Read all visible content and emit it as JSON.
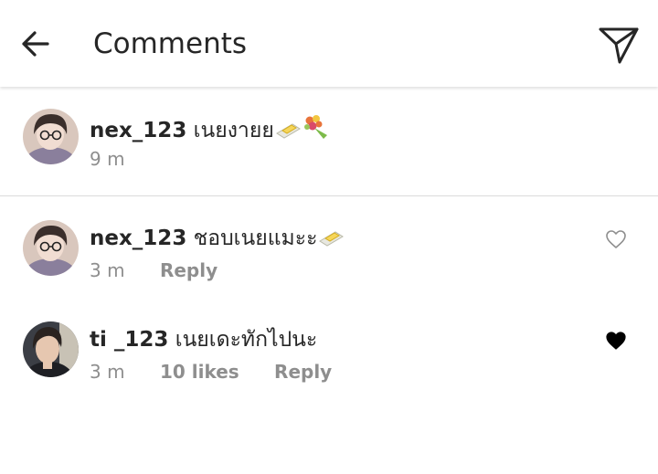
{
  "header": {
    "title": "Comments",
    "back_icon": "arrow-left-icon",
    "share_icon": "paper-plane-icon"
  },
  "caption": {
    "username": "nex_123",
    "text": "เนยงายย",
    "emojis": [
      "butter-emoji",
      "bouquet-emoji"
    ],
    "time": "9 m"
  },
  "comments": [
    {
      "username": "nex_123",
      "text": "ชอบเนยแมะะ",
      "emojis": [
        "butter-emoji"
      ],
      "time": "3 m",
      "likes": "",
      "reply_label": "Reply",
      "liked": false
    },
    {
      "username": "ti _123",
      "text": "เนยเดะทักไปนะ",
      "emojis": [],
      "time": "3 m",
      "likes": "10 likes",
      "reply_label": "Reply",
      "liked": true
    }
  ],
  "colors": {
    "text": "#262626",
    "muted": "#8e8e8e",
    "divider": "#dbdbdb",
    "heart_filled": "#000000"
  }
}
